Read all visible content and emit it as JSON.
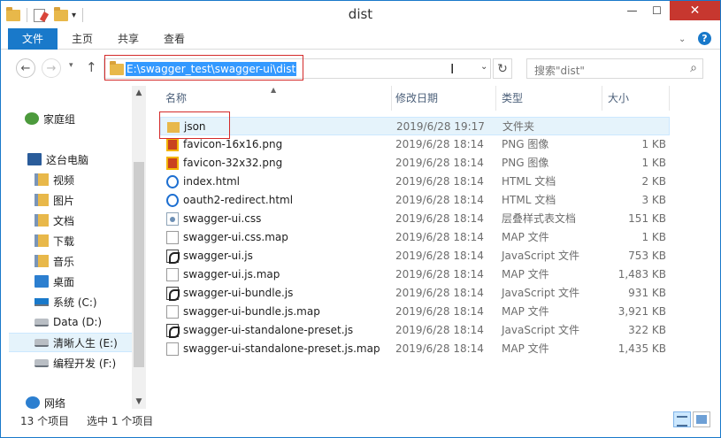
{
  "window": {
    "title": "dist"
  },
  "ribbon": {
    "tabs": [
      "文件",
      "主页",
      "共享",
      "查看"
    ]
  },
  "address": {
    "path": "E:\\swagger_test\\swagger-ui\\dist"
  },
  "search": {
    "placeholder": "搜索\"dist\""
  },
  "nav": {
    "items": [
      {
        "label": "家庭组",
        "icon": "homegroup-icon"
      },
      {
        "label": "这台电脑",
        "icon": "computer-icon"
      },
      {
        "label": "视频",
        "icon": "library-videos-icon"
      },
      {
        "label": "图片",
        "icon": "library-pictures-icon"
      },
      {
        "label": "文档",
        "icon": "library-documents-icon"
      },
      {
        "label": "下载",
        "icon": "downloads-icon"
      },
      {
        "label": "音乐",
        "icon": "library-music-icon"
      },
      {
        "label": "桌面",
        "icon": "desktop-icon"
      },
      {
        "label": "系统 (C:)",
        "icon": "windows-drive-icon"
      },
      {
        "label": "Data (D:)",
        "icon": "drive-icon"
      },
      {
        "label": "清晰人生 (E:)",
        "icon": "drive-icon",
        "selected": true
      },
      {
        "label": "编程开发 (F:)",
        "icon": "drive-icon"
      },
      {
        "label": "网络",
        "icon": "network-icon"
      }
    ]
  },
  "columns": {
    "name": "名称",
    "date": "修改日期",
    "type": "类型",
    "size": "大小"
  },
  "files": [
    {
      "name": "json",
      "date": "2019/6/28 19:17",
      "type": "文件夹",
      "size": "",
      "icon": "folder-icon",
      "selected": true
    },
    {
      "name": "favicon-16x16.png",
      "date": "2019/6/28 18:14",
      "type": "PNG 图像",
      "size": "1 KB",
      "icon": "png-file-icon"
    },
    {
      "name": "favicon-32x32.png",
      "date": "2019/6/28 18:14",
      "type": "PNG 图像",
      "size": "1 KB",
      "icon": "png-file-icon"
    },
    {
      "name": "index.html",
      "date": "2019/6/28 18:14",
      "type": "HTML 文档",
      "size": "2 KB",
      "icon": "html-file-icon"
    },
    {
      "name": "oauth2-redirect.html",
      "date": "2019/6/28 18:14",
      "type": "HTML 文档",
      "size": "3 KB",
      "icon": "html-file-icon"
    },
    {
      "name": "swagger-ui.css",
      "date": "2019/6/28 18:14",
      "type": "层叠样式表文档",
      "size": "151 KB",
      "icon": "css-file-icon"
    },
    {
      "name": "swagger-ui.css.map",
      "date": "2019/6/28 18:14",
      "type": "MAP 文件",
      "size": "1 KB",
      "icon": "map-file-icon"
    },
    {
      "name": "swagger-ui.js",
      "date": "2019/6/28 18:14",
      "type": "JavaScript 文件",
      "size": "753 KB",
      "icon": "js-file-icon"
    },
    {
      "name": "swagger-ui.js.map",
      "date": "2019/6/28 18:14",
      "type": "MAP 文件",
      "size": "1,483 KB",
      "icon": "map-file-icon"
    },
    {
      "name": "swagger-ui-bundle.js",
      "date": "2019/6/28 18:14",
      "type": "JavaScript 文件",
      "size": "931 KB",
      "icon": "js-file-icon"
    },
    {
      "name": "swagger-ui-bundle.js.map",
      "date": "2019/6/28 18:14",
      "type": "MAP 文件",
      "size": "3,921 KB",
      "icon": "map-file-icon"
    },
    {
      "name": "swagger-ui-standalone-preset.js",
      "date": "2019/6/28 18:14",
      "type": "JavaScript 文件",
      "size": "322 KB",
      "icon": "js-file-icon"
    },
    {
      "name": "swagger-ui-standalone-preset.js.map",
      "date": "2019/6/28 18:14",
      "type": "MAP 文件",
      "size": "1,435 KB",
      "icon": "map-file-icon"
    }
  ],
  "status": {
    "count": "13 个项目",
    "selection": "选中 1 个项目"
  },
  "colors": {
    "accent": "#1979ca",
    "close": "#c7372f",
    "annotation": "#d42a2a",
    "selection": "#e5f3fb"
  }
}
